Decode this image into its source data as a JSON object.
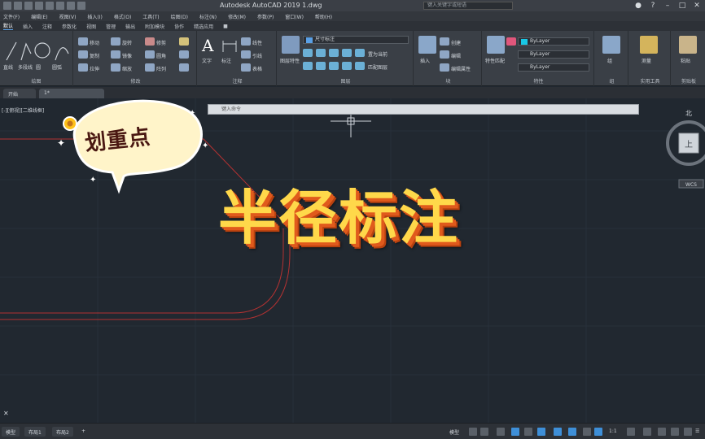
{
  "window": {
    "title": "Autodesk AutoCAD 2019    1.dwg",
    "search_placeholder": "键入关键字或短语"
  },
  "menu": [
    "文件(F)",
    "编辑(E)",
    "视图(V)",
    "插入(I)",
    "格式(O)",
    "工具(T)",
    "绘图(D)",
    "标注(N)",
    "修改(M)",
    "参数(P)",
    "窗口(W)",
    "帮助(H)"
  ],
  "ribbon_tabs": [
    "默认",
    "插入",
    "注释",
    "参数化",
    "视图",
    "管理",
    "输出",
    "附加模块",
    "协作",
    "精选应用"
  ],
  "ribbon": {
    "panels": {
      "draw": "绘图",
      "modify": "修改",
      "annotation": "注释",
      "layers": "图层",
      "block": "块",
      "properties": "特性",
      "groups": "组",
      "utilities": "实用工具",
      "clipboard": "剪贴板"
    },
    "draw_tools": [
      "直线",
      "多段线",
      "圆",
      "圆弧"
    ],
    "modify_tools": [
      "移动",
      "旋转",
      "修剪",
      "复制",
      "镜像",
      "圆角",
      "拉伸",
      "缩放",
      "阵列"
    ],
    "annotation_tools": [
      "文字",
      "标注",
      "线性",
      "引线",
      "表格"
    ],
    "layer_tools": [
      "图层特性",
      "置为当前",
      "匹配图层"
    ],
    "layer_dropdown": "尺寸标注",
    "block_tools": [
      "插入",
      "创建",
      "编辑",
      "编辑属性"
    ],
    "properties": {
      "label": "特性匹配",
      "color": "ByLayer",
      "linetype": "ByLayer",
      "lineweight": "ByLayer"
    },
    "group_label": "组",
    "measure_label": "测量",
    "paste_label": "粘贴"
  },
  "file_tabs": [
    "开始",
    "1*"
  ],
  "viewport_label": "[-][俯视][二维线框]",
  "command_placeholder": "键入命令",
  "viewcube": {
    "north": "北",
    "top": "上",
    "wcs": "WCS"
  },
  "layout_tabs": [
    "模型",
    "布局1",
    "布局2"
  ],
  "status": {
    "model": "模型",
    "scale": "1:1"
  },
  "overlay": {
    "sticker_text": "划重点",
    "main_title": "半径标注"
  },
  "colors": {
    "canvas": "#212830",
    "title_fill": "#ffd84a",
    "title_shadow": "#e05a1c",
    "drawing_line": "#b33232"
  }
}
